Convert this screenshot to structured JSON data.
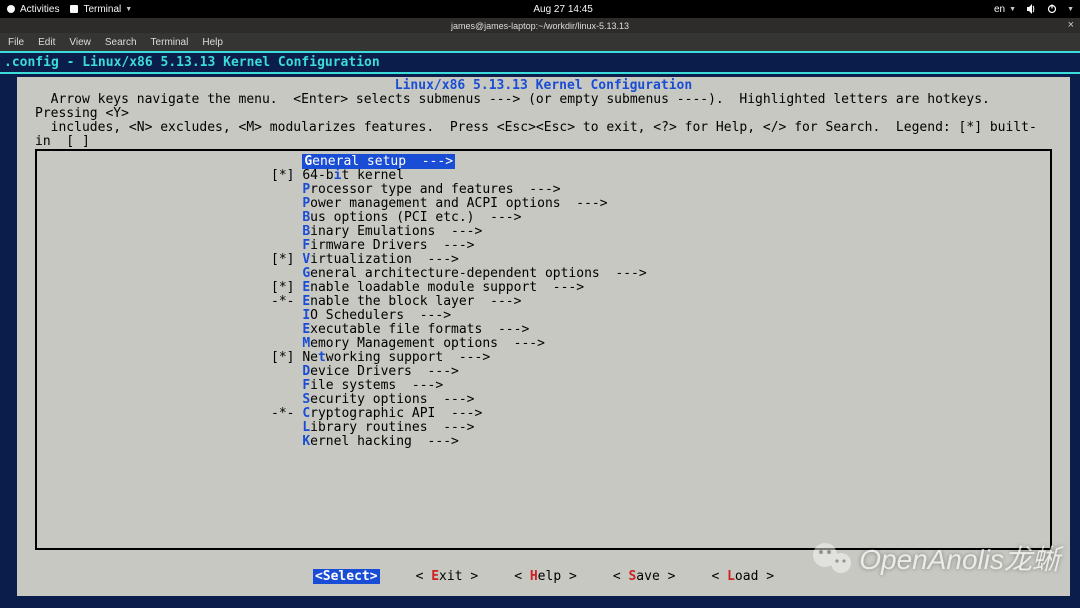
{
  "desktop": {
    "activities": "Activities",
    "app_label": "Terminal",
    "clock": "Aug 27  14:45",
    "lang": "en"
  },
  "window": {
    "title": "james@james-laptop:~/workdir/linux-5.13.13"
  },
  "menubar": [
    "File",
    "Edit",
    "View",
    "Search",
    "Terminal",
    "Help"
  ],
  "config": {
    "banner": ".config - Linux/x86 5.13.13 Kernel Configuration",
    "inner_title": "Linux/x86 5.13.13 Kernel Configuration",
    "help_lines": "  Arrow keys navigate the menu.  <Enter> selects submenus ---> (or empty submenus ----).  Highlighted letters are hotkeys.  Pressing <Y>\n  includes, <N> excludes, <M> modularizes features.  Press <Esc><Esc> to exit, <?> for Help, </> for Search.  Legend: [*] built-in  [ ]\n  excluded  <M> module  < > module capable"
  },
  "menu": [
    {
      "prefix": "    ",
      "hot": "G",
      "rest": "eneral setup  --->",
      "sel": true
    },
    {
      "prefix": "[*] ",
      "hot": "6",
      "rest": "4-bit kernel",
      "hotpos": 3
    },
    {
      "prefix": "    ",
      "hot": "P",
      "rest": "rocessor type and features  --->"
    },
    {
      "prefix": "    ",
      "hot": "P",
      "rest": "ower management and ACPI options  --->"
    },
    {
      "prefix": "    ",
      "hot": "B",
      "rest": "us options (PCI etc.)  --->"
    },
    {
      "prefix": "    ",
      "hot": "B",
      "rest": "inary Emulations  --->"
    },
    {
      "prefix": "    ",
      "hot": "F",
      "rest": "irmware Drivers  --->"
    },
    {
      "prefix": "[*] ",
      "hot": "V",
      "rest": "irtualization  --->"
    },
    {
      "prefix": "    ",
      "hot": "G",
      "rest": "eneral architecture-dependent options  --->"
    },
    {
      "prefix": "[*] ",
      "hot": "E",
      "rest": "nable loadable module support  --->"
    },
    {
      "prefix": "-*- ",
      "hot": "E",
      "rest": "nable the block layer  --->"
    },
    {
      "prefix": "    ",
      "hot": "I",
      "rest": "O Schedulers  --->"
    },
    {
      "prefix": "    ",
      "hot": "E",
      "rest": "xecutable file formats  --->"
    },
    {
      "prefix": "    ",
      "hot": "M",
      "rest": "emory Management options  --->"
    },
    {
      "prefix": "[*] ",
      "hot": "N",
      "rest": "etworking support  --->",
      "hotpos": 1
    },
    {
      "prefix": "    ",
      "hot": "D",
      "rest": "evice Drivers  --->"
    },
    {
      "prefix": "    ",
      "hot": "F",
      "rest": "ile systems  --->"
    },
    {
      "prefix": "    ",
      "hot": "S",
      "rest": "ecurity options  --->"
    },
    {
      "prefix": "-*- ",
      "hot": "C",
      "rest": "ryptographic API  --->"
    },
    {
      "prefix": "    ",
      "hot": "L",
      "rest": "ibrary routines  --->"
    },
    {
      "prefix": "    ",
      "hot": "K",
      "rest": "ernel hacking  --->"
    }
  ],
  "buttons": {
    "select": {
      "pre": "<",
      "hot": "S",
      "rest": "elect>",
      "sel": true
    },
    "exit": {
      "pre": "< ",
      "hot": "E",
      "rest": "xit >"
    },
    "help": {
      "pre": "< ",
      "hot": "H",
      "rest": "elp >"
    },
    "save": {
      "pre": "< ",
      "hot": "S",
      "rest": "ave >"
    },
    "load": {
      "pre": "< ",
      "hot": "L",
      "rest": "oad >"
    }
  },
  "watermark": "OpenAnolis龙蜥"
}
